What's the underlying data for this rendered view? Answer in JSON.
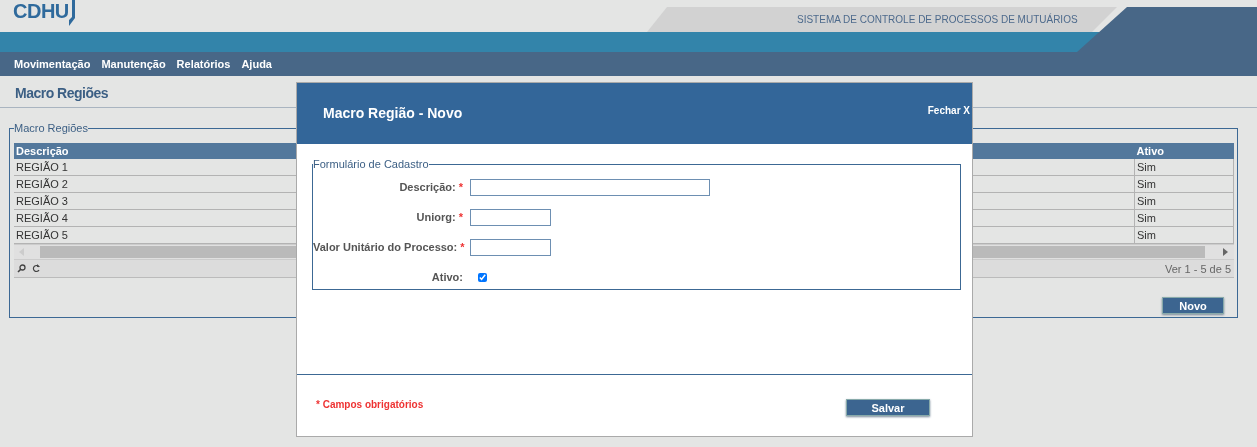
{
  "header": {
    "logo": "CDHU",
    "system_title": "SISTEMA DE CONTROLE DE PROCESSOS DE MUTUÁRIOS"
  },
  "menu": [
    "Movimentação",
    "Manutenção",
    "Relatórios",
    "Ajuda"
  ],
  "page_title": "Macro Regiões",
  "group": {
    "legend": "Macro Regiões",
    "table": {
      "columns": [
        "Descrição",
        "Ativo"
      ],
      "rows": [
        [
          "REGIÃO 1",
          "Sim"
        ],
        [
          "REGIÃO 2",
          "Sim"
        ],
        [
          "REGIÃO 3",
          "Sim"
        ],
        [
          "REGIÃO 4",
          "Sim"
        ],
        [
          "REGIÃO 5",
          "Sim"
        ]
      ],
      "pager": "Ver 1 - 5 de 5"
    },
    "button": "Novo"
  },
  "modal": {
    "title": "Macro Região - Novo",
    "close": "Fechar X",
    "legend": "Formulário de Cadastro",
    "fields": [
      {
        "kind": "text",
        "label": "Descrição:",
        "required_mark": "*",
        "wide": true
      },
      {
        "kind": "text",
        "label": "Uniorg:",
        "required_mark": "*",
        "wide": false
      },
      {
        "kind": "text",
        "label": "Valor Unitário do Processo:",
        "required_mark": "*",
        "wide": false
      },
      {
        "kind": "checkbox",
        "label": "Ativo:",
        "checked": true
      }
    ],
    "required_note": "* Campos obrigatórios",
    "button": "Salvar"
  }
}
